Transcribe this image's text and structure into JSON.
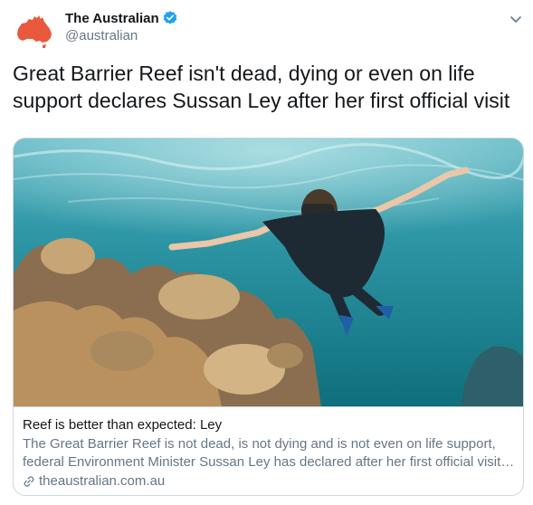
{
  "account": {
    "name": "The Australian",
    "handle": "@australian",
    "avatar_icon": "australia-map-icon",
    "avatar_color": "#e8593d",
    "verified": true,
    "verified_color": "#1da1f2"
  },
  "tweet": {
    "text": "Great Barrier Reef isn't dead, dying or even on life support declares Sussan Ley after her first official visit"
  },
  "card": {
    "image_icon": "snorkeler-reef-photo",
    "title": "Reef is better than expected: Ley",
    "description": "The Great Barrier Reef is not dead, is not dying and is not even on life support, federal Environment Minister Sussan Ley has declared after her first official visit to the reef.",
    "domain": "theaustralian.com.au",
    "domain_icon": "link-icon"
  },
  "menu_icon": "chevron-down-icon",
  "colors": {
    "text": "#14171a",
    "secondary": "#657786",
    "border": "#ccd6dd"
  }
}
